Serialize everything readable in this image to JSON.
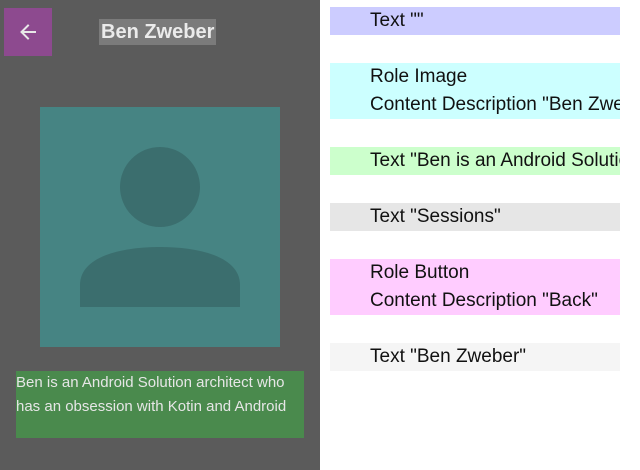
{
  "screen": {
    "back_button": {
      "icon": "arrow-back-icon"
    },
    "title": "Ben Zweber",
    "avatar": {
      "icon": "person-placeholder-icon"
    },
    "bio": "Ben is an Android Solution architect who has an obsession with Kotin and Android"
  },
  "semantics": [
    {
      "lines": [
        "Text \"\""
      ],
      "color": "#ccccff"
    },
    {
      "lines": [
        "Role Image",
        "Content Description \"Ben Zweber\""
      ],
      "color": "#ccffff"
    },
    {
      "lines": [
        "Text \"Ben is an Android Solution architect who has an obsession with Kotin and Android\""
      ],
      "color": "#ccffcc"
    },
    {
      "lines": [
        "Text \"Sessions\""
      ],
      "color": "#e6e6e6"
    },
    {
      "lines": [
        "Role Button",
        "Content Description \"Back\""
      ],
      "color": "#ffccff"
    },
    {
      "lines": [
        "Text \"Ben Zweber\""
      ],
      "color": "#f5f5f5"
    }
  ],
  "colors": {
    "background": "#5b5b5b",
    "back_button": "#8d4a8f",
    "avatar": "#468483",
    "bio": "#4a8a4d"
  }
}
